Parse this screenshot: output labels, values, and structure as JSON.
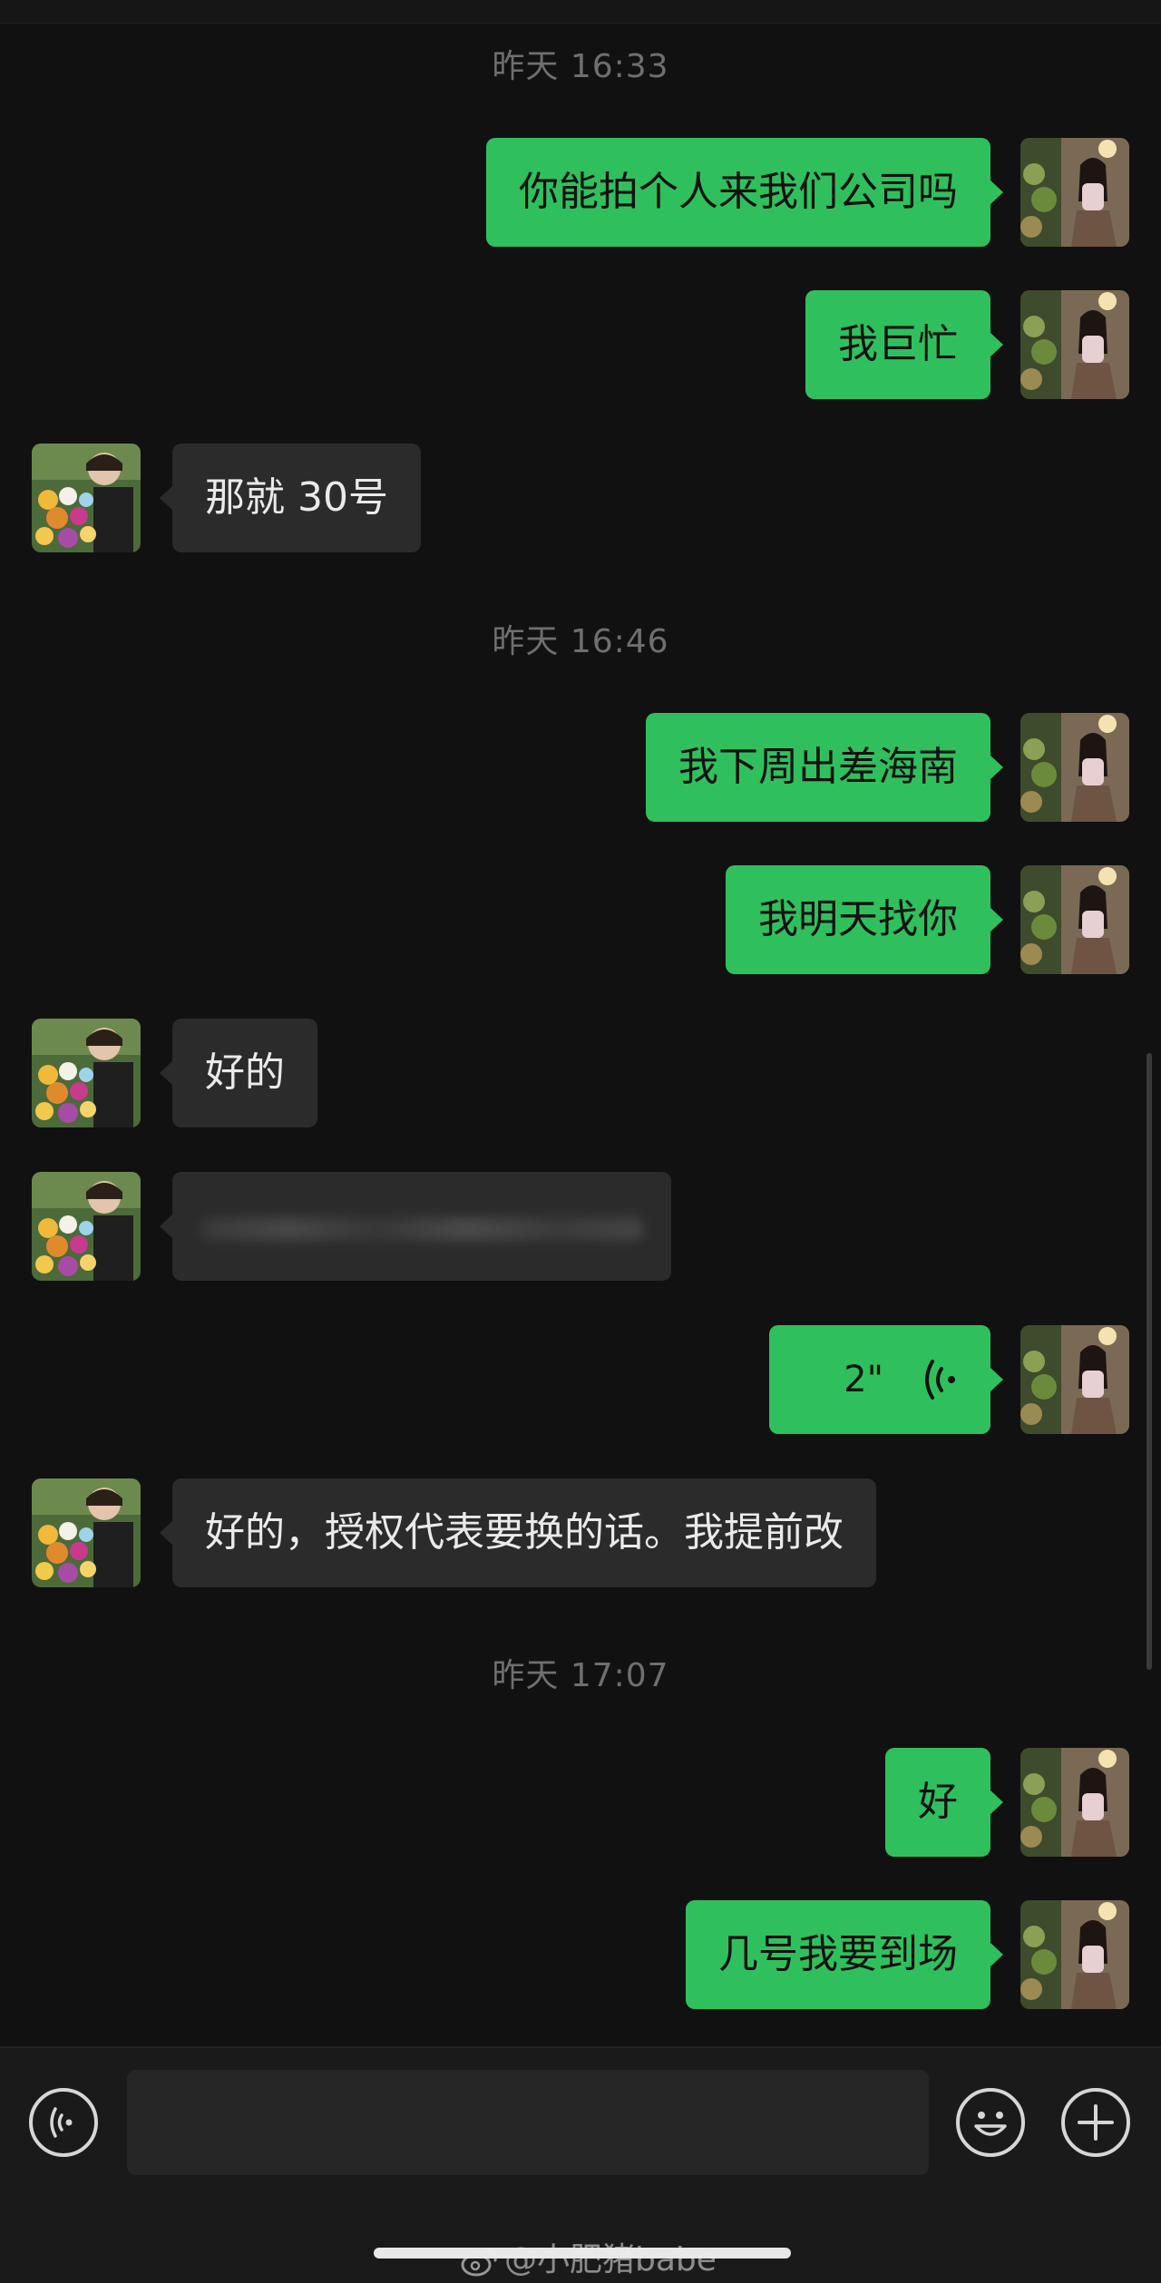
{
  "chat": {
    "timestamps": [
      "昨天 16:33",
      "昨天 16:46",
      "昨天 17:07"
    ],
    "messages": [
      {
        "sender": "self",
        "type": "text",
        "text": "你能拍个人来我们公司吗"
      },
      {
        "sender": "self",
        "type": "text",
        "text": "我巨忙"
      },
      {
        "sender": "other",
        "type": "text",
        "text": "那就 30号"
      },
      {
        "sender": "self",
        "type": "text",
        "text": "我下周出差海南"
      },
      {
        "sender": "self",
        "type": "text",
        "text": "我明天找你"
      },
      {
        "sender": "other",
        "type": "text",
        "text": "好的"
      },
      {
        "sender": "other",
        "type": "blurred"
      },
      {
        "sender": "self",
        "type": "voice",
        "duration": "2\""
      },
      {
        "sender": "other",
        "type": "text",
        "text": "好的，授权代表要换的话。我提前改"
      },
      {
        "sender": "self",
        "type": "text",
        "text": "好"
      },
      {
        "sender": "self",
        "type": "text",
        "text": "几号我要到场"
      }
    ]
  },
  "input_bar": {
    "text_value": "",
    "icons": [
      "voice-input-icon",
      "emoji-icon",
      "plus-icon"
    ]
  },
  "watermark": {
    "text": "@小肥猪babe"
  },
  "colors": {
    "background": "#111111",
    "self_bubble": "#2fc05d",
    "other_bubble": "#2b2b2b",
    "timestamp": "#6f6f6f"
  }
}
